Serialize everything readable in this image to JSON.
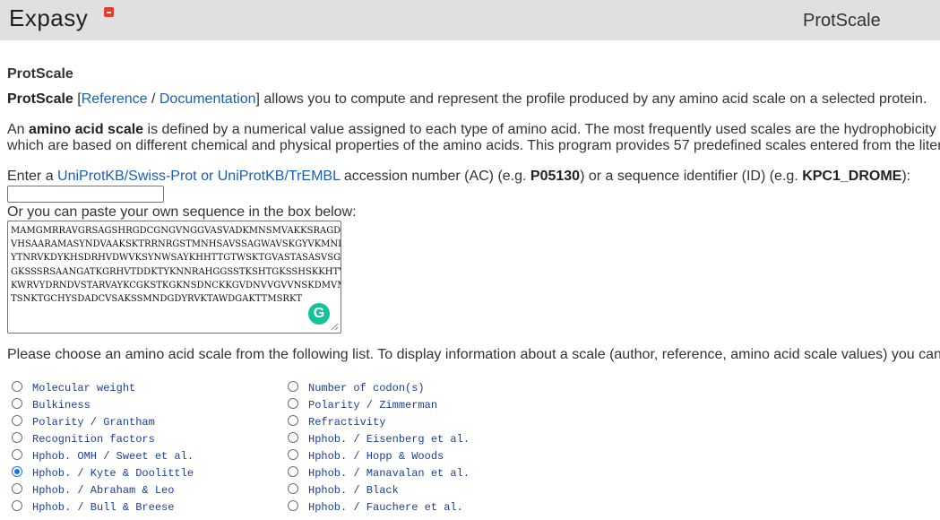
{
  "header": {
    "logo_text": "Expasy",
    "title": "ProtScale"
  },
  "main": {
    "heading": "ProtScale",
    "intro": {
      "name": "ProtScale",
      "bracket_open": " [",
      "reference_link": "Reference",
      "slash": " / ",
      "documentation_link": "Documentation",
      "rest": "] allows you to compute and represent the profile produced by any amino acid scale on a selected protein."
    },
    "definition": {
      "line1_pre": "An ",
      "line1_bold": "amino acid scale",
      "line1_rest": " is defined by a numerical value assigned to each type of amino acid. The most frequently used scales are the hydrophobicity",
      "line2": "which are based on different chemical and physical properties of the amino acids. This program provides 57 predefined scales entered from the liter"
    },
    "enter": {
      "pre": "Enter a ",
      "link": "UniProtKB/Swiss-Prot or UniProtKB/TrEMBL",
      "mid1": " accession number (AC) (e.g. ",
      "ex1": "P05130",
      "mid2": ") or a sequence identifier (ID) (e.g. ",
      "ex2": "KPC1_DROME",
      "end": "):"
    },
    "ac_input": {
      "value": "",
      "placeholder": ""
    },
    "paste_label": "Or you can paste your own sequence in the box below:",
    "sequence_lines": [
      "MAMGMRRAVGRSAGSHRGDCGNGVNGGVASVADKMNSMVAKKSRAGDVTHAM",
      "VHSAARAMASYNDVAAKSKTRRNRGSTMNHSAVSSAGWAVSKGYVKMNDAAT",
      "YTNRVKDYKHSDRHVDWVKSYNWSAYKHHTTGTWSKTGVASTASASVSGGGS",
      "GKSSSRSAANGATKGRHVTDDKTYKNNRAHGGSSTKSHTGKSSHSKKHTVGK",
      "KWRVYDRNDVSTARVAYKCGKSTKGKNSDNCKKGVDNVVGVVNSKDMVMGKV",
      "TSNKTGCHYSDADCVSAKSSMNDGDYRVKTAWDGAKTTMSRKT"
    ],
    "choose_text": "Please choose an amino acid scale from the following list. To display information about a scale (author, reference, amino acid scale values) you can",
    "scales_left": [
      {
        "label": "Molecular weight",
        "checked": false
      },
      {
        "label": "Bulkiness",
        "checked": false
      },
      {
        "label": "Polarity / Grantham",
        "checked": false
      },
      {
        "label": "Recognition factors",
        "checked": false
      },
      {
        "label": "Hphob. OMH / Sweet et al.",
        "checked": false
      },
      {
        "label": "Hphob. / Kyte & Doolittle",
        "checked": true
      },
      {
        "label": "Hphob. / Abraham & Leo",
        "checked": false
      },
      {
        "label": "Hphob. / Bull & Breese",
        "checked": false
      }
    ],
    "scales_right": [
      {
        "label": "Number of codon(s)",
        "checked": false
      },
      {
        "label": "Polarity / Zimmerman",
        "checked": false
      },
      {
        "label": "Refractivity",
        "checked": false
      },
      {
        "label": "Hphob. / Eisenberg et al.",
        "checked": false
      },
      {
        "label": "Hphob. / Hopp & Woods",
        "checked": false
      },
      {
        "label": "Hphob. / Manavalan et al.",
        "checked": false
      },
      {
        "label": "Hphob. / Black",
        "checked": false
      },
      {
        "label": "Hphob. / Fauchere et al.",
        "checked": false
      }
    ],
    "colors": {
      "link": "#1a5fb4",
      "header_bg": "#e0e0e0",
      "logo_mark": "#e43d2f",
      "grammarly": "#15c39a",
      "radio_checked": "#1a73e8"
    }
  }
}
